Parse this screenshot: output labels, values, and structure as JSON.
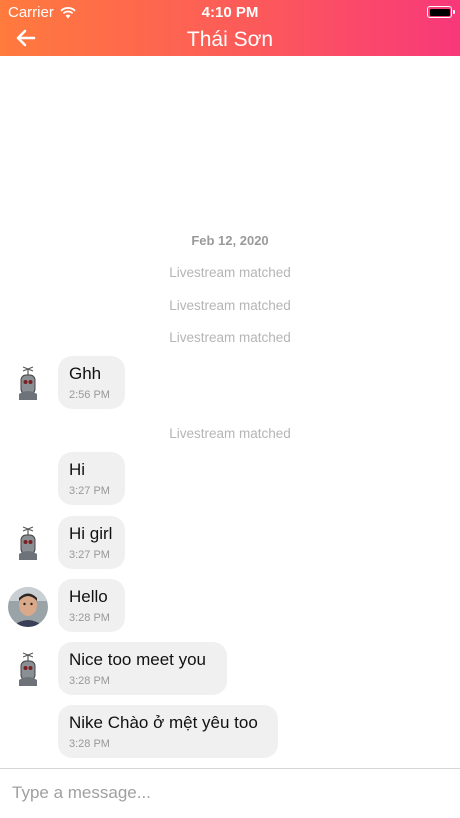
{
  "status_bar": {
    "carrier": "Carrier",
    "time": "4:10 PM"
  },
  "header": {
    "title": "Thái Sơn",
    "back_icon": "arrow-left-icon",
    "gradient": [
      "#ff7a3d",
      "#f8387a"
    ]
  },
  "chat": {
    "date_separator": "Feb 12, 2020",
    "system_message": "Livestream matched",
    "messages": [
      {
        "text": "Ghh",
        "time": "2:56 PM",
        "avatar": "robot-avatar"
      },
      {
        "text": "Hi",
        "time": "3:27 PM",
        "avatar": ""
      },
      {
        "text": "Hi girl",
        "time": "3:27 PM",
        "avatar": "robot-avatar"
      },
      {
        "text": "Hello",
        "time": "3:28 PM",
        "avatar": "user-photo-avatar"
      },
      {
        "text": "Nice too meet you",
        "time": "3:28 PM",
        "avatar": "robot-avatar"
      },
      {
        "text": "Nike Chào ở mệt yêu too",
        "time": "3:28 PM",
        "avatar": ""
      }
    ]
  },
  "composer": {
    "placeholder": "Type a message..."
  }
}
